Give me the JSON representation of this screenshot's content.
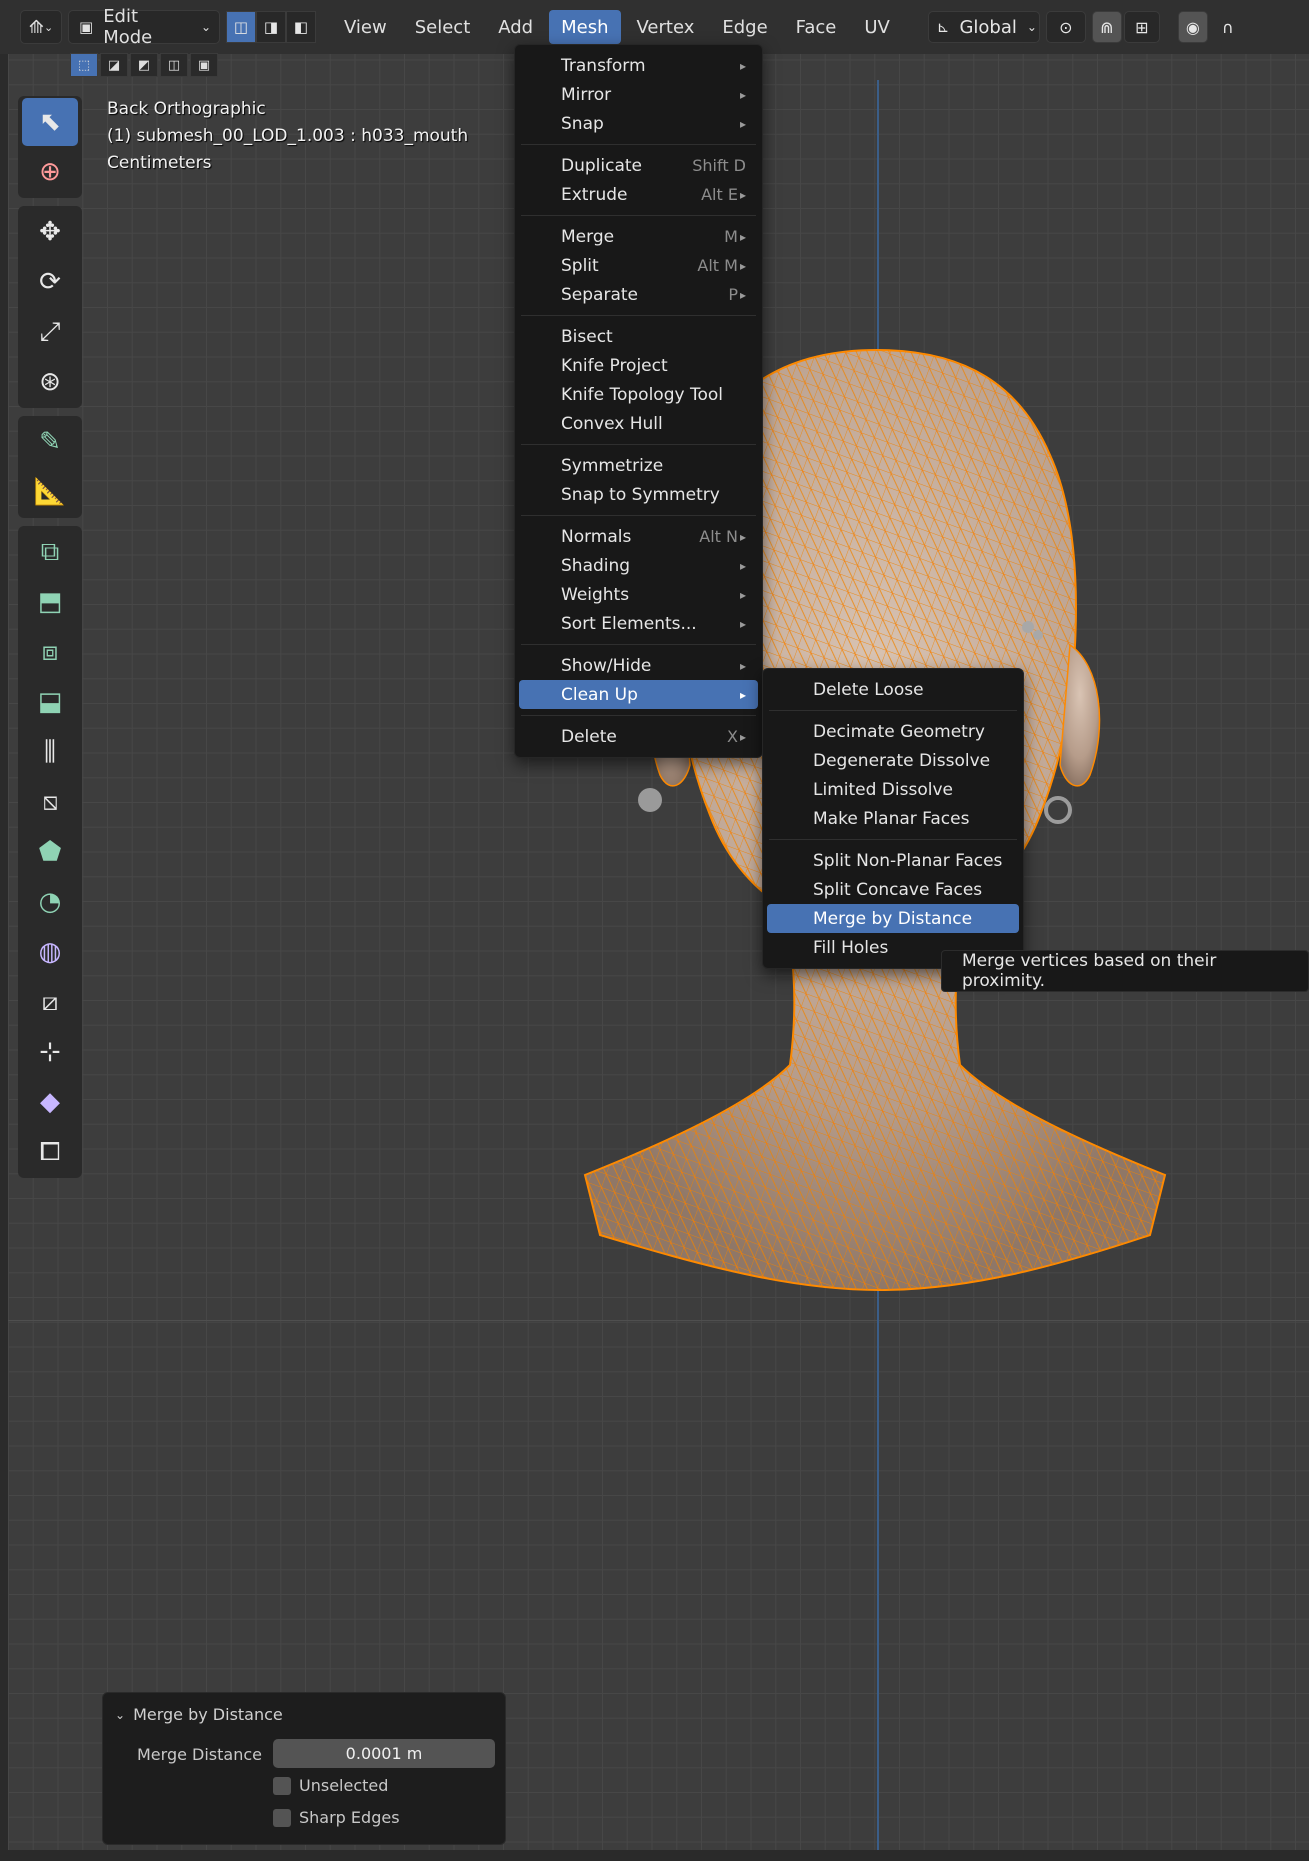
{
  "header": {
    "editor_icon": "viewport-editor-icon",
    "mode": "Edit Mode",
    "menus": [
      "View",
      "Select",
      "Add",
      "Mesh",
      "Vertex",
      "Edge",
      "Face",
      "UV"
    ],
    "open_menu": "Mesh",
    "transform_orientation": "Global"
  },
  "viewport_info": {
    "view": "Back Orthographic",
    "object": "(1) submesh_00_LOD_1.003 : h033_mouth",
    "units": "Centimeters"
  },
  "mesh_menu": {
    "items": [
      {
        "label": "Transform",
        "shortcut": "",
        "submenu": true
      },
      {
        "label": "Mirror",
        "shortcut": "",
        "submenu": true
      },
      {
        "label": "Snap",
        "shortcut": "",
        "submenu": true
      },
      {
        "label": "Duplicate",
        "shortcut": "Shift D",
        "submenu": false
      },
      {
        "label": "Extrude",
        "shortcut": "Alt E",
        "submenu": true
      },
      {
        "label": "Merge",
        "shortcut": "M",
        "submenu": true
      },
      {
        "label": "Split",
        "shortcut": "Alt M",
        "submenu": true
      },
      {
        "label": "Separate",
        "shortcut": "P",
        "submenu": true
      },
      {
        "label": "Bisect",
        "shortcut": "",
        "submenu": false
      },
      {
        "label": "Knife Project",
        "shortcut": "",
        "submenu": false
      },
      {
        "label": "Knife Topology Tool",
        "shortcut": "",
        "submenu": false
      },
      {
        "label": "Convex Hull",
        "shortcut": "",
        "submenu": false
      },
      {
        "label": "Symmetrize",
        "shortcut": "",
        "submenu": false
      },
      {
        "label": "Snap to Symmetry",
        "shortcut": "",
        "submenu": false
      },
      {
        "label": "Normals",
        "shortcut": "Alt N",
        "submenu": true
      },
      {
        "label": "Shading",
        "shortcut": "",
        "submenu": true
      },
      {
        "label": "Weights",
        "shortcut": "",
        "submenu": true
      },
      {
        "label": "Sort Elements...",
        "shortcut": "",
        "submenu": true
      },
      {
        "label": "Show/Hide",
        "shortcut": "",
        "submenu": true
      },
      {
        "label": "Clean Up",
        "shortcut": "",
        "submenu": true
      },
      {
        "label": "Delete",
        "shortcut": "X",
        "submenu": true
      }
    ]
  },
  "cleanup_menu": {
    "items": [
      "Delete Loose",
      "Decimate Geometry",
      "Degenerate Dissolve",
      "Limited Dissolve",
      "Make Planar Faces",
      "Split Non-Planar Faces",
      "Split Concave Faces",
      "Merge by Distance",
      "Fill Holes"
    ],
    "highlighted": "Merge by Distance"
  },
  "tooltip": "Merge vertices based on their proximity.",
  "operator_panel": {
    "title": "Merge by Distance",
    "merge_distance_label": "Merge Distance",
    "merge_distance_value": "0.0001 m",
    "unselected_label": "Unselected",
    "unselected_checked": false,
    "sharp_edges_label": "Sharp Edges",
    "sharp_edges_checked": false
  },
  "colors": {
    "accent": "#4772b3",
    "mesh_wire": "#ff8a00",
    "mesh_surface": "#c9b3a3",
    "viewport_bg": "#3d3d3d",
    "menu_bg": "#181818"
  }
}
